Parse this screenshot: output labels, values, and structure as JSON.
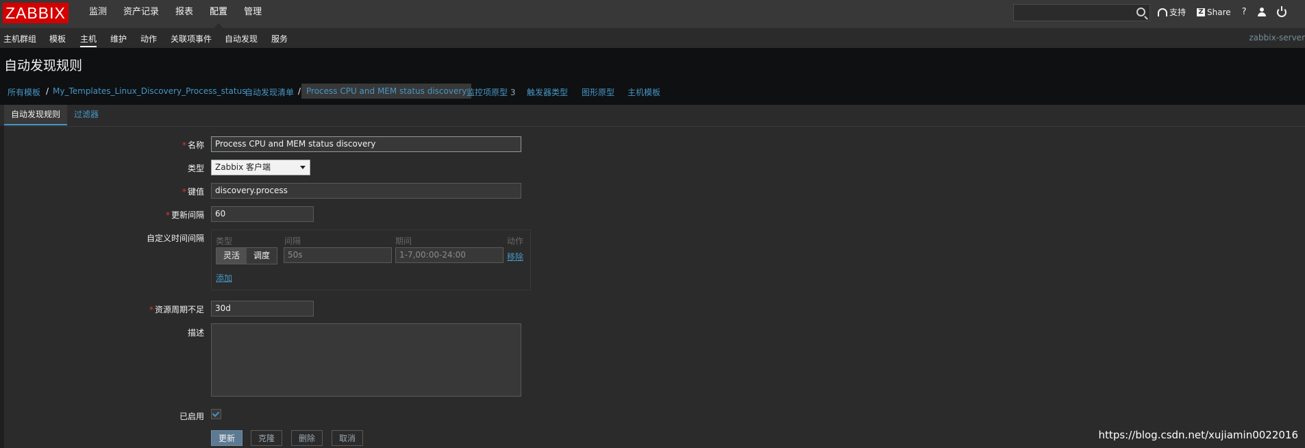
{
  "topnav": {
    "logo": "ZABBIX",
    "menu": [
      "监测",
      "资产记录",
      "报表",
      "配置",
      "管理"
    ],
    "active_menu": "配置",
    "search_value": "",
    "support_label": "支持",
    "share_label": "Share",
    "help_label": "?"
  },
  "subnav": {
    "items": [
      "主机群组",
      "模板",
      "主机",
      "维护",
      "动作",
      "关联项事件",
      "自动发现",
      "服务"
    ],
    "active": "主机",
    "server_name": "zabbix-server"
  },
  "page": {
    "title": "自动发现规则"
  },
  "breadcrumbs": {
    "all_templates": "所有模板",
    "sep": "/",
    "template": "My_Templates_Linux_Discovery_Process_status",
    "discovery_list": "自动发现清单",
    "current": "Process CPU and MEM status discovery",
    "item_prototypes": "监控项原型",
    "item_prototypes_count": "3",
    "trigger_prototypes": "触发器类型",
    "graph_prototypes": "图形原型",
    "host_prototypes": "主机模板"
  },
  "tabs": {
    "discovery_rule": "自动发现规则",
    "filters": "过滤器"
  },
  "form": {
    "name_label": "名称",
    "name_value": "Process CPU and MEM status discovery",
    "type_label": "类型",
    "type_value": "Zabbix 客户端",
    "key_label": "键值",
    "key_value": "discovery.process",
    "interval_label": "更新间隔",
    "interval_value": "60",
    "custom_intervals_label": "自定义时间间隔",
    "ci_headers": {
      "type": "类型",
      "interval": "间隔",
      "period": "期间",
      "action": "动作"
    },
    "ci_flexible": "灵活",
    "ci_scheduling": "调度",
    "ci_interval_value": "50s",
    "ci_period_value": "1-7,00:00-24:00",
    "ci_remove": "移除",
    "ci_add": "添加",
    "lifetime_label": "资源周期不足",
    "lifetime_value": "30d",
    "description_label": "描述",
    "description_value": "",
    "enabled_label": "已启用",
    "enabled": true
  },
  "buttons": {
    "update": "更新",
    "clone": "克隆",
    "delete": "删除",
    "cancel": "取消"
  },
  "watermark": "https://blog.csdn.net/xujiamin0022016",
  "colors": {
    "accent": "#4796c4",
    "logo_red": "#d40000",
    "required": "#e33734"
  }
}
